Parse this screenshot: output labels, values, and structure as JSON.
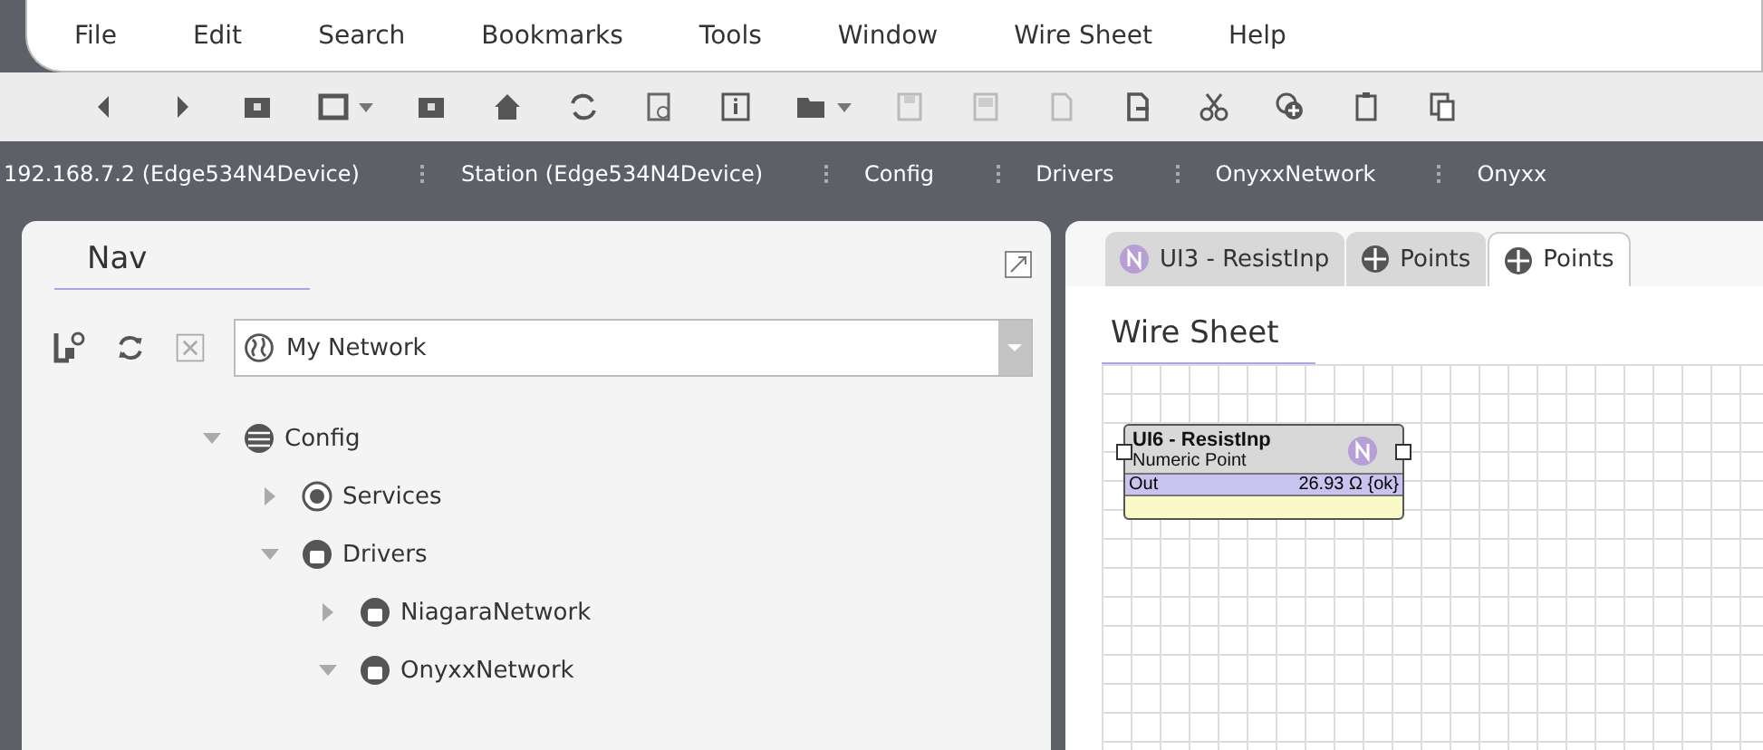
{
  "menu": [
    "File",
    "Edit",
    "Search",
    "Bookmarks",
    "Tools",
    "Window",
    "Wire Sheet",
    "Help"
  ],
  "breadcrumbs": [
    "192.168.7.2 (Edge534N4Device)",
    "Station (Edge534N4Device)",
    "Config",
    "Drivers",
    "OnyxxNetwork",
    "Onyxx"
  ],
  "nav": {
    "title": "Nav",
    "network_selector": {
      "value": "My Network"
    },
    "tree": [
      {
        "label": "Config",
        "kind": "database",
        "expanded": true,
        "children": [
          {
            "label": "Services",
            "kind": "services",
            "expanded": false
          },
          {
            "label": "Drivers",
            "kind": "driver",
            "expanded": true,
            "children": [
              {
                "label": "NiagaraNetwork",
                "kind": "driver",
                "expanded": false
              },
              {
                "label": "OnyxxNetwork",
                "kind": "driver",
                "expanded": true
              }
            ]
          }
        ]
      }
    ]
  },
  "tabs": [
    {
      "label": "UI3 - ResistInp",
      "kind": "numeric",
      "selected": false
    },
    {
      "label": "Points",
      "kind": "points",
      "selected": false
    },
    {
      "label": "Points",
      "kind": "points",
      "selected": true
    }
  ],
  "view_title": "Wire Sheet",
  "node": {
    "title": "UI6 - ResistInp",
    "type": "Numeric Point",
    "slot": "Out",
    "value": "26.93 Ω {ok}"
  }
}
